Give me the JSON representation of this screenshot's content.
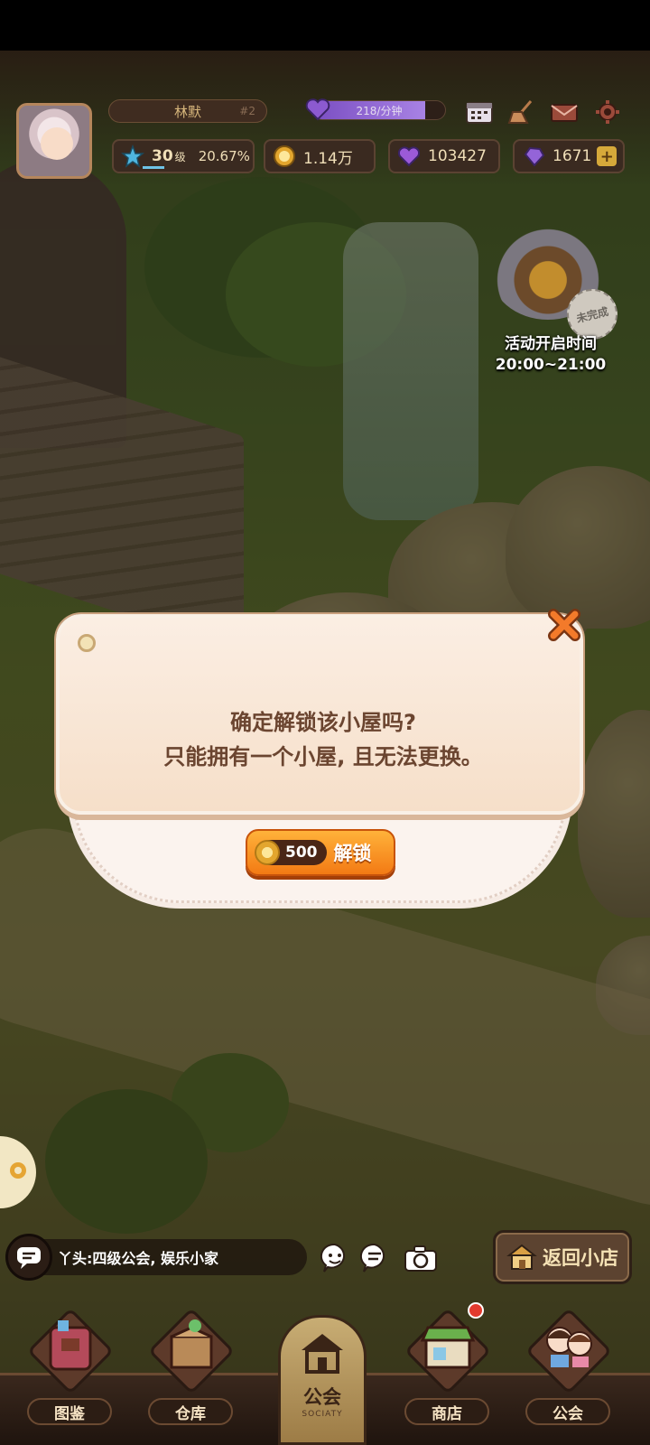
{
  "player": {
    "name": "林默",
    "rank": "#2",
    "energy_text": "218/分钟",
    "energy_fraction": 0.85
  },
  "resources": {
    "level": "30",
    "level_unit": "级",
    "level_progress": "20.67%",
    "coins": "1.14万",
    "hearts": "103427",
    "gems": "1671"
  },
  "event": {
    "badge": "未完成",
    "title": "活动开启时间",
    "time": "20:00~21:00"
  },
  "dialog": {
    "line1": "确定解锁该小屋吗?",
    "line2": "只能拥有一个小屋, 且无法更换。",
    "cost": "500",
    "button_label": "解锁"
  },
  "chat": {
    "message": "丫头:四级公会, 娱乐小家"
  },
  "return_button": "返回小店",
  "nav": {
    "items": [
      {
        "label": "图鉴"
      },
      {
        "label": "仓库"
      },
      {
        "label": "公会",
        "sub": "SOCIATY"
      },
      {
        "label": "商店"
      },
      {
        "label": "公会"
      }
    ]
  },
  "icons": {
    "energy": "purple-heart-icon",
    "calendar": "calendar-icon",
    "broom": "broom-icon",
    "mail": "mail-icon",
    "settings": "gear-icon",
    "star": "star-level-icon",
    "coin": "coin-icon",
    "heart": "heart-icon",
    "gem": "gem-icon",
    "close": "close-icon",
    "chat": "chat-bubble-icon",
    "emoji": "emoji-icon",
    "quick_msg": "quick-message-icon",
    "camera": "camera-icon",
    "shop": "shop-icon"
  },
  "colors": {
    "accent_orange": "#f37a14",
    "dialog_text": "#6b4530",
    "energy_purple": "#7a4ec2"
  }
}
